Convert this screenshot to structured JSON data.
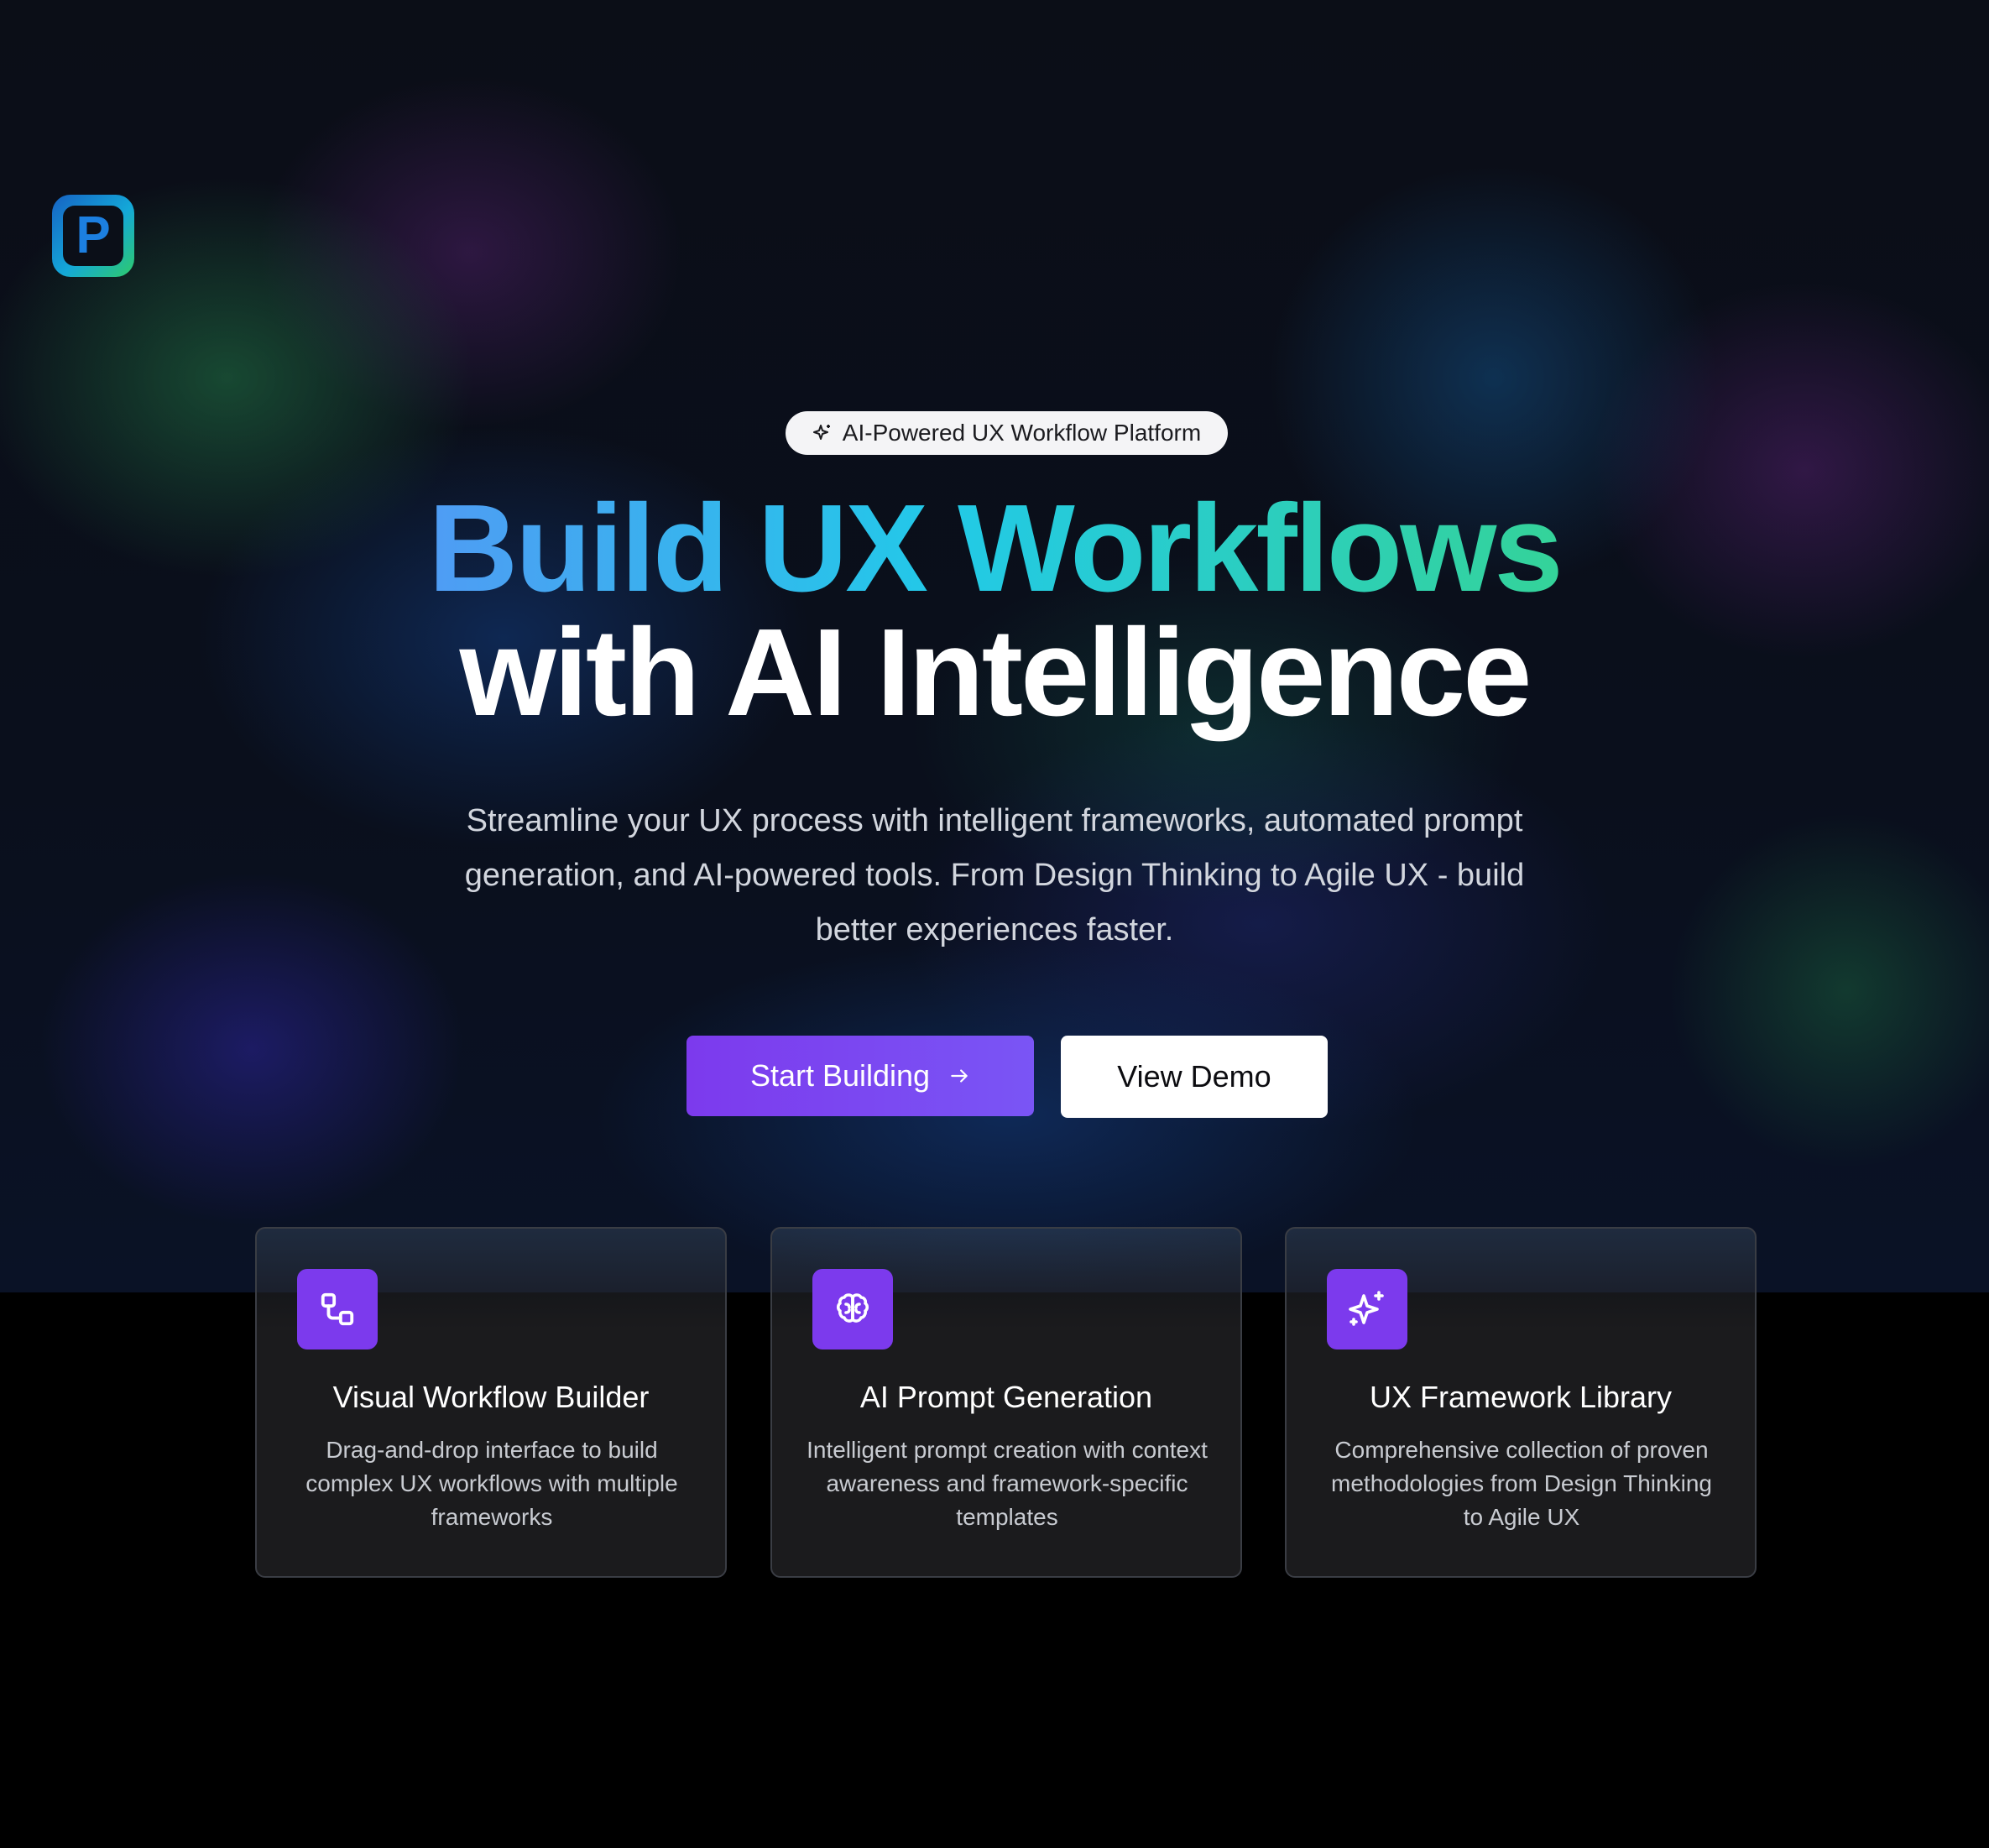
{
  "badge": {
    "text": "AI-Powered UX Workflow Platform",
    "icon": "sparkle-icon"
  },
  "hero": {
    "headline_line1": "Build UX Workflows",
    "headline_line2": "with AI Intelligence",
    "subtitle": "Streamline your UX process with intelligent frameworks, automated prompt generation, and AI-powered tools. From Design Thinking to Agile UX - build better experiences faster."
  },
  "actions": {
    "primary_label": "Start Building",
    "secondary_label": "View Demo"
  },
  "features": [
    {
      "icon": "workflow-icon",
      "title": "Visual Workflow Builder",
      "description": "Drag-and-drop interface to build complex UX workflows with multiple frameworks"
    },
    {
      "icon": "brain-icon",
      "title": "AI Prompt Generation",
      "description": "Intelligent prompt creation with context awareness and framework-specific templates"
    },
    {
      "icon": "sparkles-icon",
      "title": "UX Framework Library",
      "description": "Comprehensive collection of proven methodologies from Design Thinking to Agile UX"
    }
  ],
  "colors": {
    "accent": "#7c3aed",
    "gradient_start": "#4f9cf4",
    "gradient_mid": "#22c9e8",
    "gradient_end": "#34d399",
    "background": "#000000"
  }
}
